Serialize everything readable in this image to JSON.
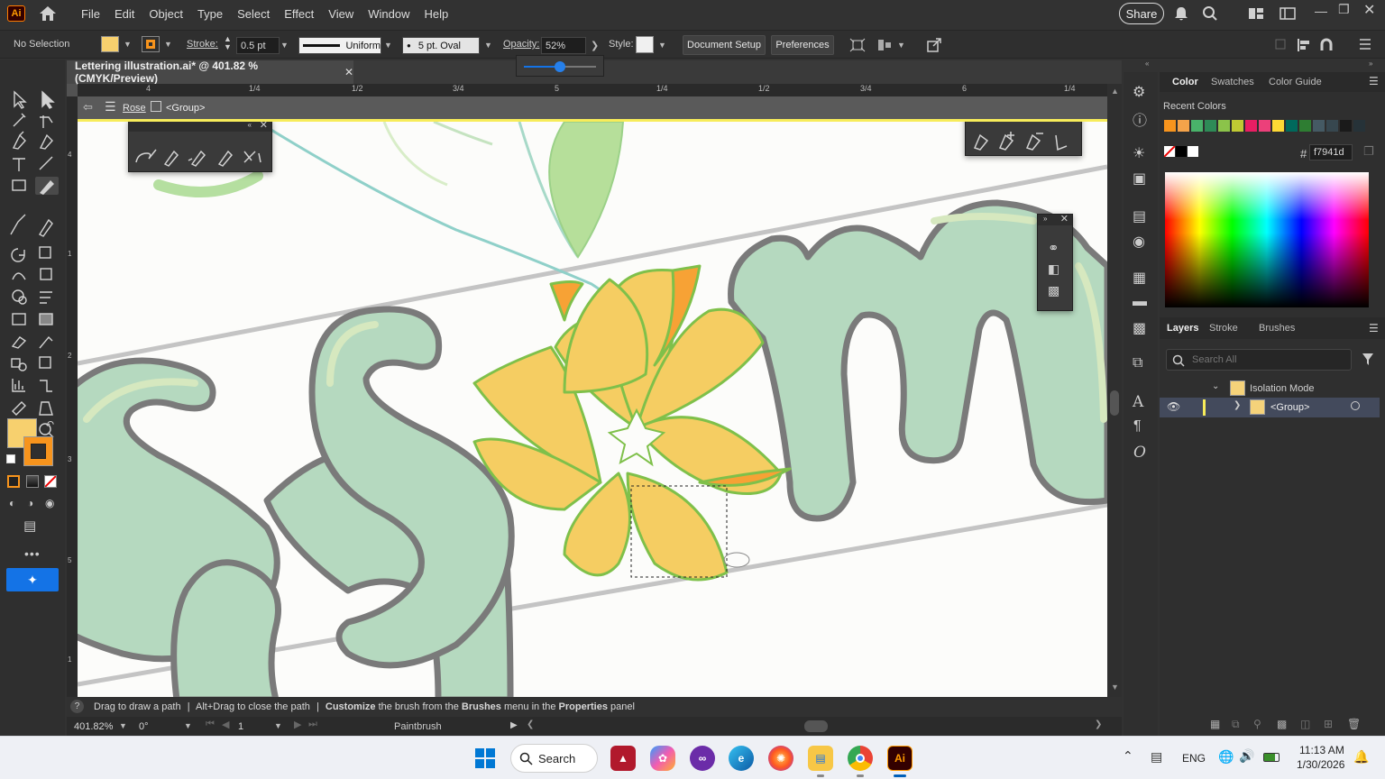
{
  "app": {
    "logo": "Ai",
    "menu": [
      "File",
      "Edit",
      "Object",
      "Type",
      "Select",
      "Effect",
      "View",
      "Window",
      "Help"
    ],
    "share_label": "Share"
  },
  "control_bar": {
    "selection": "No Selection",
    "stroke_label": "Stroke:",
    "stroke_value": "0.5 pt",
    "profile": "Uniform",
    "brush": "5 pt. Oval",
    "opacity_label": "Opacity:",
    "opacity_value": "52%",
    "style_label": "Style:",
    "document_setup": "Document Setup",
    "preferences": "Preferences",
    "fill_color": "#f7d06e",
    "stroke_color": "#f7941d"
  },
  "document": {
    "tab_title": "Lettering illustration.ai* @ 401.82 % (CMYK/Preview)",
    "breadcrumb": [
      "Rose",
      "<Group>"
    ],
    "ruler_marks": [
      "4",
      "1/4",
      "1/2",
      "3/4",
      "5",
      "1/4",
      "1/2",
      "3/4",
      "6",
      "1/4"
    ],
    "ruler_left_marks": [
      "4",
      "1",
      "2",
      "3",
      "5",
      "1"
    ]
  },
  "status": {
    "hint_1": "Drag to draw a path",
    "hint_sep1": "|",
    "hint_2": "Alt+Drag to close the path",
    "hint_sep2": "|",
    "hint_3a": "Customize",
    "hint_3b": "the brush from the",
    "hint_3c": "Brushes",
    "hint_3d": "menu in the",
    "hint_3e": "Properties",
    "hint_3f": "panel"
  },
  "nav": {
    "zoom": "401.82%",
    "rotation": "0°",
    "artboard": "1",
    "tool": "Paintbrush"
  },
  "color_panel": {
    "tabs": [
      "Color",
      "Swatches",
      "Color Guide"
    ],
    "recent_label": "Recent Colors",
    "recent_colors": [
      "#f7941d",
      "#f4a34a",
      "#49b36a",
      "#2e8b57",
      "#8bc34a",
      "#c0ca33",
      "#e91e63",
      "#ec407a",
      "#fdd835",
      "#00695c",
      "#2e7d32",
      "#455a64",
      "#37474f",
      "#1a1a1a",
      "#263238"
    ],
    "hex_label": "#",
    "hex_value": "f7941d"
  },
  "layers_panel": {
    "tabs": [
      "Layers",
      "Stroke",
      "Brushes"
    ],
    "search_placeholder": "Search All",
    "rows": [
      {
        "name": "Isolation Mode"
      },
      {
        "name": "<Group>"
      }
    ]
  },
  "taskbar": {
    "search_label": "Search",
    "language": "ENG",
    "time": "11:13 AM",
    "date": "1/30/2026"
  }
}
